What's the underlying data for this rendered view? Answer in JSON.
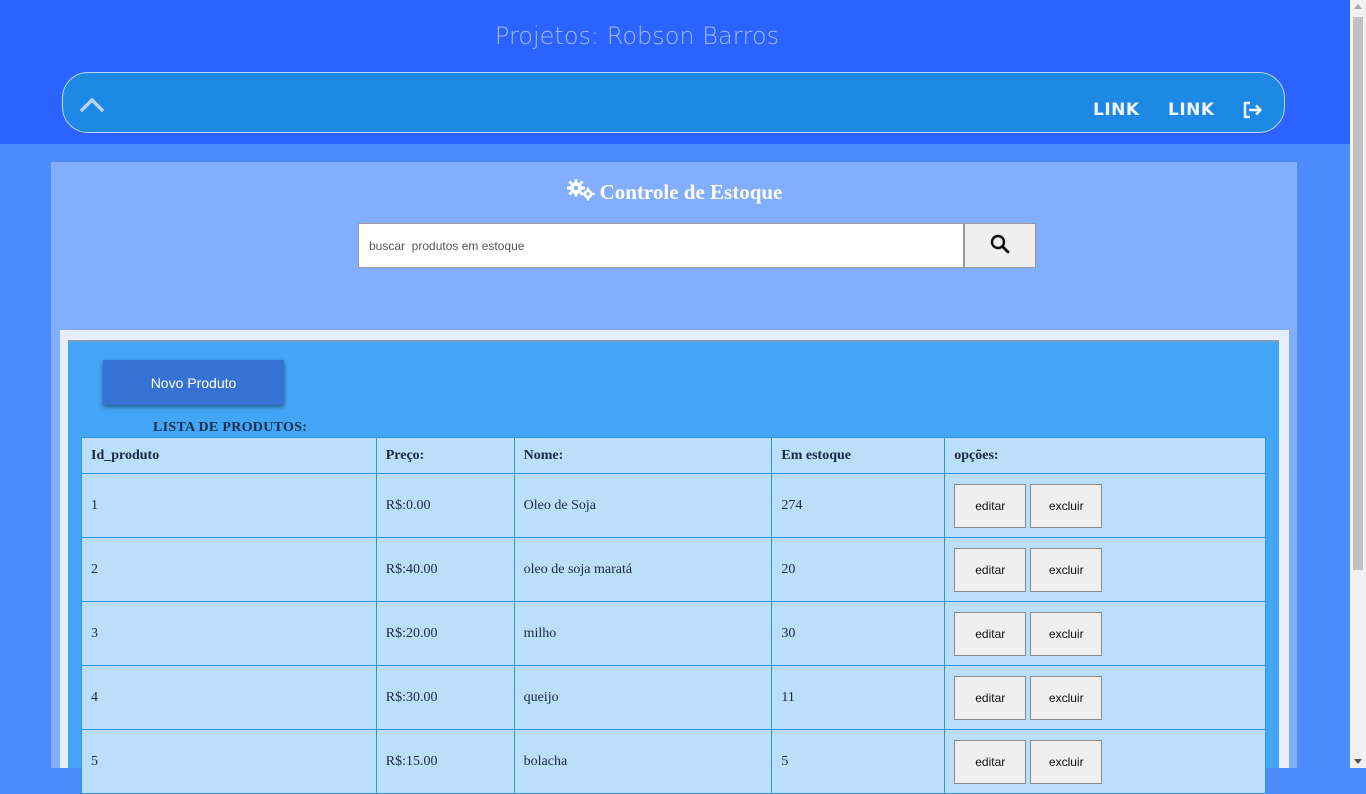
{
  "header": {
    "title": "Projetos: Robson Barros"
  },
  "nav": {
    "links": [
      "LINK",
      "LINK"
    ]
  },
  "panel": {
    "title": "Controle de Estoque",
    "search_placeholder": "buscar  produtos em estoque",
    "new_product_label": "Novo Produto",
    "list_caption": "LISTA DE PRODUTOS:"
  },
  "table": {
    "columns": [
      "Id_produto",
      "Preço:",
      "Nome:",
      "Em estoque",
      "opções:"
    ],
    "rows": [
      {
        "id": "1",
        "price": "R$:0.00",
        "name": "Oleo de Soja",
        "stock": "274"
      },
      {
        "id": "2",
        "price": "R$:40.00",
        "name": "oleo de soja maratá",
        "stock": "20"
      },
      {
        "id": "3",
        "price": "R$:20.00",
        "name": "milho",
        "stock": "30"
      },
      {
        "id": "4",
        "price": "R$:30.00",
        "name": "queijo",
        "stock": "11"
      },
      {
        "id": "5",
        "price": "R$:15.00",
        "name": "bolacha",
        "stock": "5"
      }
    ],
    "edit_label": "editar",
    "delete_label": "excluir"
  },
  "colors": {
    "header_bg": "#2c62ff",
    "navbar_bg": "#1e88e5",
    "panel_bg": "#82aefd",
    "table_bg": "#bbdefb",
    "button_bg": "#3572d4"
  },
  "icons": [
    "chevron-up-icon",
    "logout-icon",
    "gears-icon",
    "search-icon"
  ]
}
